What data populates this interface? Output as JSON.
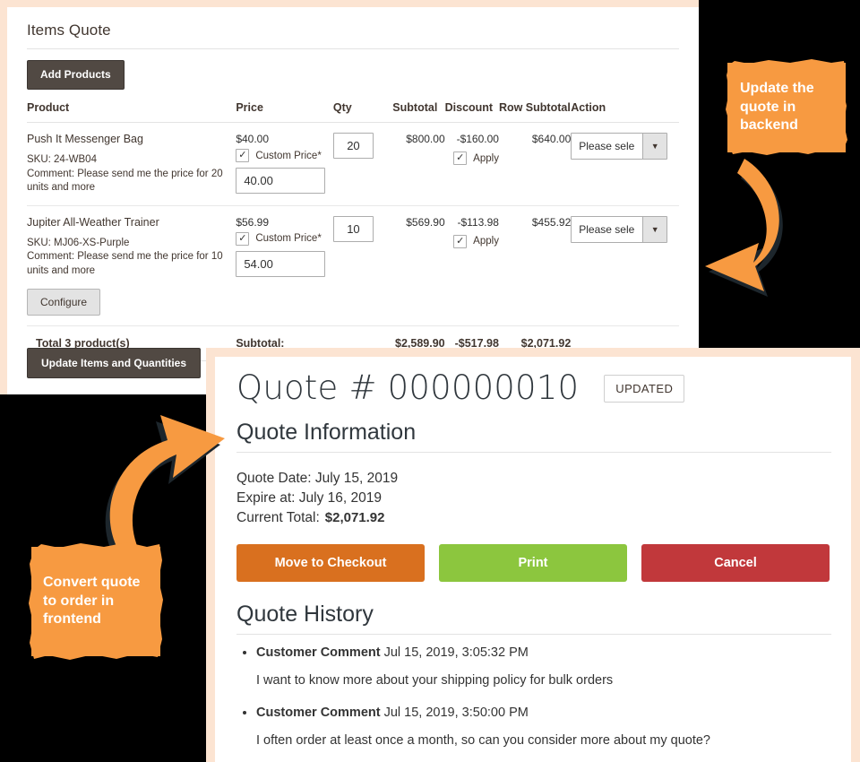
{
  "backend": {
    "section_title": "Items Quote",
    "add_products_label": "Add Products",
    "update_button_label": "Update Items and Quantities",
    "columns": {
      "product": "Product",
      "price": "Price",
      "qty": "Qty",
      "subtotal": "Subtotal",
      "discount": "Discount",
      "row_subtotal": "Row Subtotal",
      "action": "Action"
    },
    "rows": [
      {
        "name": "Push It Messenger Bag",
        "sku": "SKU: 24-WB04",
        "comment": "Comment: Please send me the price for 20 units and more",
        "price": "$40.00",
        "custom_price_label": "Custom Price*",
        "custom_price_value": "40.00",
        "qty": "20",
        "subtotal": "$800.00",
        "discount": "-$160.00",
        "apply_label": "Apply",
        "row_subtotal": "$640.00",
        "action_select": "Please sele",
        "has_configure": false
      },
      {
        "name": "Jupiter All-Weather Trainer",
        "sku": "SKU: MJ06-XS-Purple",
        "comment": "Comment: Please send me the price for 10 units and more",
        "price": "$56.99",
        "custom_price_label": "Custom Price*",
        "custom_price_value": "54.00",
        "qty": "10",
        "subtotal": "$569.90",
        "discount": "-$113.98",
        "apply_label": "Apply",
        "row_subtotal": "$455.92",
        "action_select": "Please sele",
        "has_configure": true,
        "configure_label": "Configure"
      }
    ],
    "totals": {
      "products_label": "Total 3 product(s)",
      "subtotal_label": "Subtotal:",
      "subtotal": "$2,589.90",
      "discount": "-$517.98",
      "row_subtotal": "$2,071.92"
    }
  },
  "quote": {
    "title": "Quote # 000000010",
    "status_badge": "UPDATED",
    "information_heading": "Quote Information",
    "quote_date": "Quote Date: July 15, 2019",
    "expire_at": "Expire at: July 16, 2019",
    "current_total_label": "Current Total:",
    "current_total_value": "$2,071.92",
    "buttons": {
      "checkout": "Move to Checkout",
      "print": "Print",
      "cancel": "Cancel"
    },
    "history_heading": "Quote History",
    "history": [
      {
        "author": "Customer Comment",
        "date": "Jul 15, 2019, 3:05:32 PM",
        "body": "I want to know more about your shipping policy for bulk orders"
      },
      {
        "author": "Customer Comment",
        "date": "Jul 15, 2019, 3:50:00 PM",
        "body": "I often order at least once a month, so can you consider more about my quote?"
      }
    ]
  },
  "callouts": {
    "backend": "Update the quote in backend",
    "frontend": "Convert quote to order in frontend"
  },
  "colors": {
    "accent_orange": "#f79a41",
    "panel_border": "#fce4d2",
    "admin_dark": "#514943",
    "checkout_orange": "#d9701f",
    "print_green": "#8cc63e",
    "cancel_red": "#c1383b",
    "background": "#000000"
  }
}
